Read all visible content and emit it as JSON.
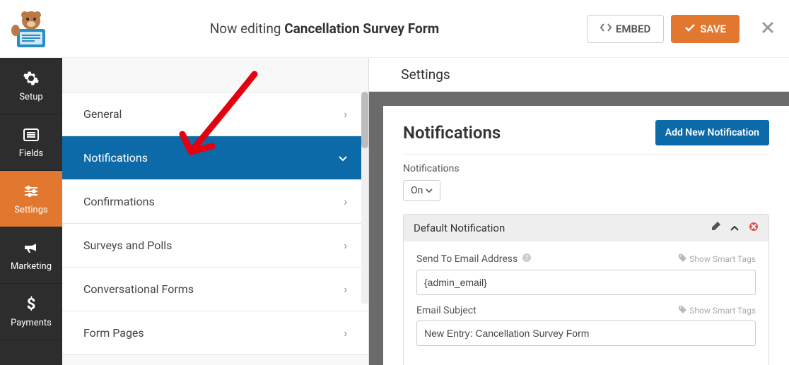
{
  "header": {
    "prefix": "Now editing ",
    "title": "Cancellation Survey Form",
    "embed": "EMBED",
    "save": "SAVE"
  },
  "sidebar": {
    "items": [
      {
        "label": "Setup"
      },
      {
        "label": "Fields"
      },
      {
        "label": "Settings"
      },
      {
        "label": "Marketing"
      },
      {
        "label": "Payments"
      }
    ]
  },
  "settings": {
    "header": "Settings",
    "items": [
      {
        "label": "General",
        "active": false
      },
      {
        "label": "Notifications",
        "active": true
      },
      {
        "label": "Confirmations",
        "active": false
      },
      {
        "label": "Surveys and Polls",
        "active": false
      },
      {
        "label": "Conversational Forms",
        "active": false
      },
      {
        "label": "Form Pages",
        "active": false
      }
    ]
  },
  "panel": {
    "title": "Notifications",
    "add_new": "Add New Notification",
    "toggle_label": "Notifications",
    "toggle_value": "On",
    "card": {
      "title": "Default Notification",
      "fields": {
        "email_label": "Send To Email Address",
        "email_value": "{admin_email}",
        "subject_label": "Email Subject",
        "subject_value": "New Entry: Cancellation Survey Form",
        "smart_tags": "Show Smart Tags"
      }
    }
  }
}
